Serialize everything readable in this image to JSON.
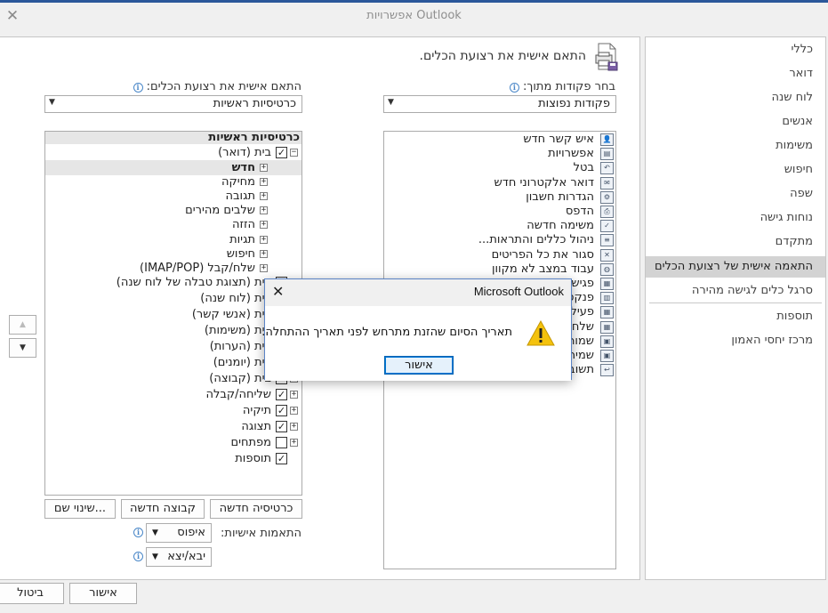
{
  "window": {
    "title": "אפשרויות Outlook",
    "close_symbol": "✕"
  },
  "nav": {
    "items": [
      "כללי",
      "דואר",
      "לוח שנה",
      "אנשים",
      "משימות",
      "חיפוש",
      "שפה",
      "נוחות גישה",
      "מתקדם",
      "התאמה אישית של רצועת הכלים",
      "סרגל כלים לגישה מהירה",
      "תוספות",
      "מרכז יחסי האמון"
    ],
    "selected_index": 9
  },
  "header": {
    "title": "התאם אישית את רצועת הכלים."
  },
  "left_column": {
    "choose_label": "בחר פקודות מתוך:",
    "choose_value": "פקודות נפוצות",
    "commands": [
      {
        "label": "איש קשר חדש",
        "icon": "contact-card-icon"
      },
      {
        "label": "אפשרויות",
        "icon": "options-icon"
      },
      {
        "label": "בטל",
        "icon": "undo-icon"
      },
      {
        "label": "דואר אלקטרוני חדש",
        "icon": "envelope-icon"
      },
      {
        "label": "הגדרות חשבון",
        "icon": "account-settings-icon"
      },
      {
        "label": "הדפס",
        "icon": "printer-icon"
      },
      {
        "label": "משימה חדשה",
        "icon": "task-icon"
      },
      {
        "label": "ניהול כללים והתראות...",
        "icon": "rules-icon"
      },
      {
        "label": "סגור את כל הפריטים",
        "icon": "close-items-icon"
      },
      {
        "label": "עבוד במצב לא מקוון",
        "icon": "offline-globe-icon"
      },
      {
        "label": "פגישה",
        "icon": "meeting-icon"
      },
      {
        "label": "פנקס",
        "icon": "address-book-icon"
      },
      {
        "label": "פעילות",
        "icon": "calendar-icon"
      },
      {
        "label": "שלח",
        "icon": "calendar-grid-icon"
      },
      {
        "label": "שמור",
        "icon": "save-as-icon"
      },
      {
        "label": "שמירה",
        "icon": "save-icon"
      },
      {
        "label": "תשובה",
        "icon": "reply-icon"
      }
    ]
  },
  "right_column": {
    "customize_label": "התאם אישית את רצועת הכלים:",
    "customize_value": "כרטיסיות ראשיות",
    "tree_header": "כרטיסיות ראשיות",
    "tree": [
      {
        "label": "בית (דואר)",
        "check": true,
        "expander": "−",
        "level": 0
      },
      {
        "label": "חדש",
        "check": null,
        "expander": "+",
        "level": 1,
        "highlight": true
      },
      {
        "label": "מחיקה",
        "check": null,
        "expander": "+",
        "level": 1
      },
      {
        "label": "תגובה",
        "check": null,
        "expander": "+",
        "level": 1
      },
      {
        "label": "שלבים מהירים",
        "check": null,
        "expander": "+",
        "level": 1
      },
      {
        "label": "הזזה",
        "check": null,
        "expander": "+",
        "level": 1
      },
      {
        "label": "תגיות",
        "check": null,
        "expander": "+",
        "level": 1
      },
      {
        "label": "חיפוש",
        "check": null,
        "expander": "+",
        "level": 1
      },
      {
        "label": "שלח/קבל (IMAP/POP)",
        "check": null,
        "expander": "+",
        "level": 1
      },
      {
        "label": "בית (תצוגת טבלה של לוח שנה)",
        "check": true,
        "expander": "+",
        "level": 0
      },
      {
        "label": "בית (לוח שנה)",
        "check": true,
        "expander": "+",
        "level": 0
      },
      {
        "label": "בית (אנשי קשר)",
        "check": true,
        "expander": "+",
        "level": 0
      },
      {
        "label": "בית (משימות)",
        "check": true,
        "expander": "+",
        "level": 0
      },
      {
        "label": "בית (הערות)",
        "check": true,
        "expander": "+",
        "level": 0
      },
      {
        "label": "בית (יומנים)",
        "check": true,
        "expander": "+",
        "level": 0
      },
      {
        "label": "בית (קבוצה)",
        "check": true,
        "expander": "+",
        "level": 0
      },
      {
        "label": "שליחה/קבלה",
        "check": true,
        "expander": "+",
        "level": 0
      },
      {
        "label": "תיקיה",
        "check": true,
        "expander": "+",
        "level": 0
      },
      {
        "label": "תצוגה",
        "check": true,
        "expander": "+",
        "level": 0
      },
      {
        "label": "מפתחים",
        "check": false,
        "expander": "+",
        "level": 0
      },
      {
        "label": "תוספות",
        "check": true,
        "expander": "",
        "level": 0
      }
    ],
    "new_tab_button": "כרטיסיה חדשה",
    "new_group_button": "קבוצה חדשה",
    "rename_button": "שינוי שם...",
    "customizations_label": "התאמות אישיות:",
    "reset_button": "איפוס",
    "import_export_button": "יבא/יצא"
  },
  "footer": {
    "ok": "אישור",
    "cancel": "ביטול"
  },
  "dialog": {
    "title": "Microsoft Outlook",
    "close_symbol": "✕",
    "message": "תאריך הסיום שהזנת מתרחש לפני תאריך ההתחלה.",
    "ok": "אישור",
    "icon": "warning-icon"
  },
  "spin": {
    "up": "▲",
    "down": "▼"
  },
  "colors": {
    "accent": "#2b579a",
    "nav_selected": "#d3d3d3",
    "dialog_border": "#5b84c6",
    "warning": "#f4c20d"
  }
}
